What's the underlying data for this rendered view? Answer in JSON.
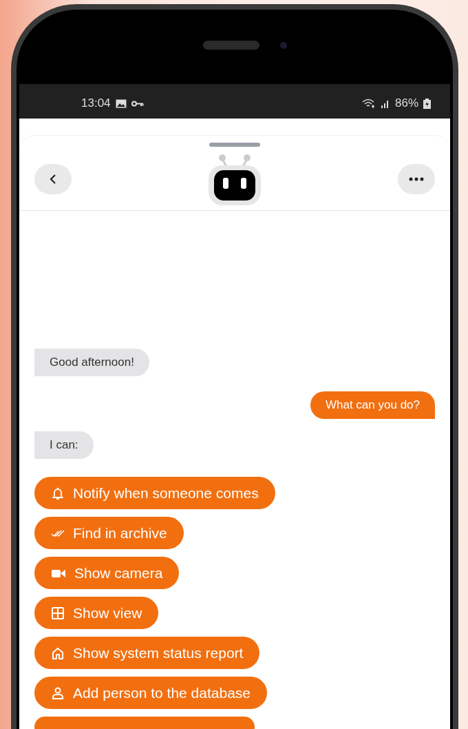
{
  "status_bar": {
    "time": "13:04",
    "battery": "86%"
  },
  "messages": [
    {
      "text": "Good afternoon!",
      "kind": "incoming"
    },
    {
      "text": "What can you do?",
      "kind": "outgoing"
    },
    {
      "text": "I can:",
      "kind": "incoming"
    }
  ],
  "actions": [
    {
      "label": "Notify when someone comes",
      "kind": "bell"
    },
    {
      "label": "Find in archive",
      "kind": "checks"
    },
    {
      "label": "Show camera",
      "kind": "camera"
    },
    {
      "label": "Show view",
      "kind": "grid"
    },
    {
      "label": "Show system status report",
      "kind": "home"
    },
    {
      "label": "Add person to the database",
      "kind": "person"
    }
  ]
}
